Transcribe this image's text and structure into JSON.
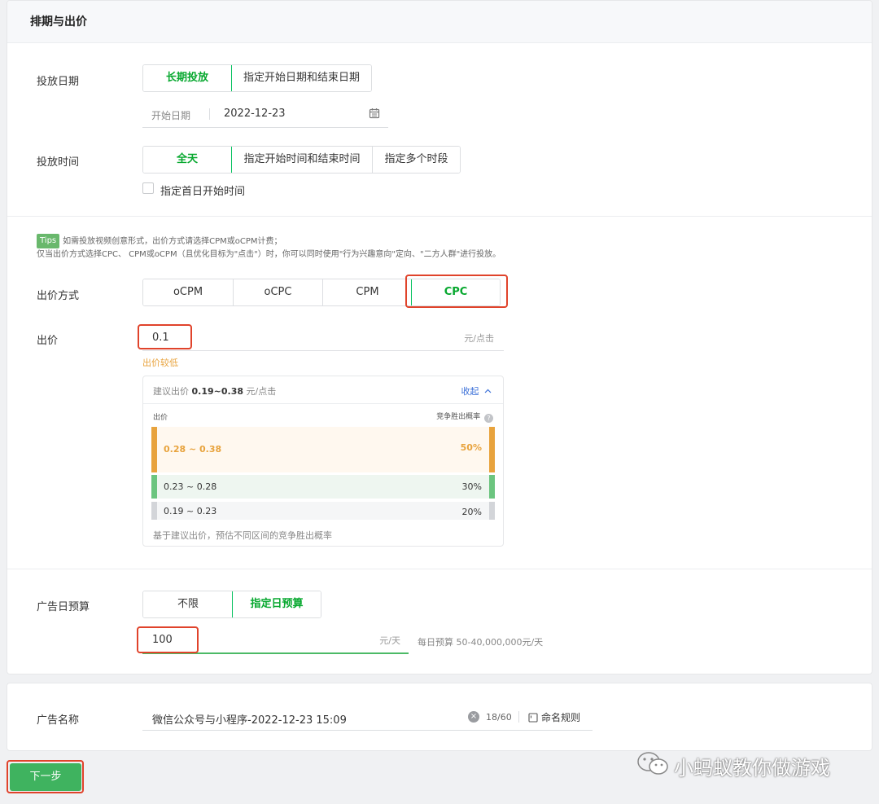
{
  "section_title": "排期与出价",
  "date": {
    "label": "投放日期",
    "options": [
      "长期投放",
      "指定开始日期和结束日期"
    ],
    "start_label": "开始日期",
    "start_value": "2022-12-23"
  },
  "time": {
    "label": "投放时间",
    "options": [
      "全天",
      "指定开始时间和结束时间",
      "指定多个时段"
    ],
    "first_day_checkbox": "指定首日开始时间"
  },
  "tips": {
    "badge": "Tips",
    "line1": "如需投放视频创意形式，出价方式请选择CPM或oCPM计费；",
    "line2": "仅当出价方式选择CPC、 CPM或oCPM（且优化目标为\"点击\"）时，你可以同时使用\"行为兴趣意向\"定向、\"二方人群\"进行投放。"
  },
  "bid_method": {
    "label": "出价方式",
    "options": [
      "oCPM",
      "oCPC",
      "CPM",
      "CPC"
    ],
    "selected": "CPC"
  },
  "bid": {
    "label": "出价",
    "value": "0.1",
    "unit": "元/点击",
    "warning": "出价较低"
  },
  "suggest": {
    "title_prefix": "建议出价",
    "range": "0.19~0.38",
    "unit": "元/点击",
    "collapse": "收起",
    "col_bid": "出价",
    "col_rate": "竞争胜出概率",
    "rows": [
      {
        "range": "0.28 ~ 0.38",
        "rate": "50%"
      },
      {
        "range": "0.23 ~ 0.28",
        "rate": "30%"
      },
      {
        "range": "0.19 ~ 0.23",
        "rate": "20%"
      }
    ],
    "footnote": "基于建议出价，预估不同区间的竞争胜出概率"
  },
  "budget": {
    "label": "广告日预算",
    "options": [
      "不限",
      "指定日预算"
    ],
    "value": "100",
    "unit": "元/天",
    "hint": "每日预算 50-40,000,000元/天"
  },
  "ad_name": {
    "label": "广告名称",
    "value": "微信公众号与小程序-2022-12-23 15:09",
    "count": "18/60",
    "rule": "命名规则"
  },
  "next_button": "下一步",
  "watermark": "小蚂蚁教你做游戏",
  "colors": {
    "accent": "#07c160",
    "warn": "#e8a33d",
    "highlight": "#e0432b"
  }
}
